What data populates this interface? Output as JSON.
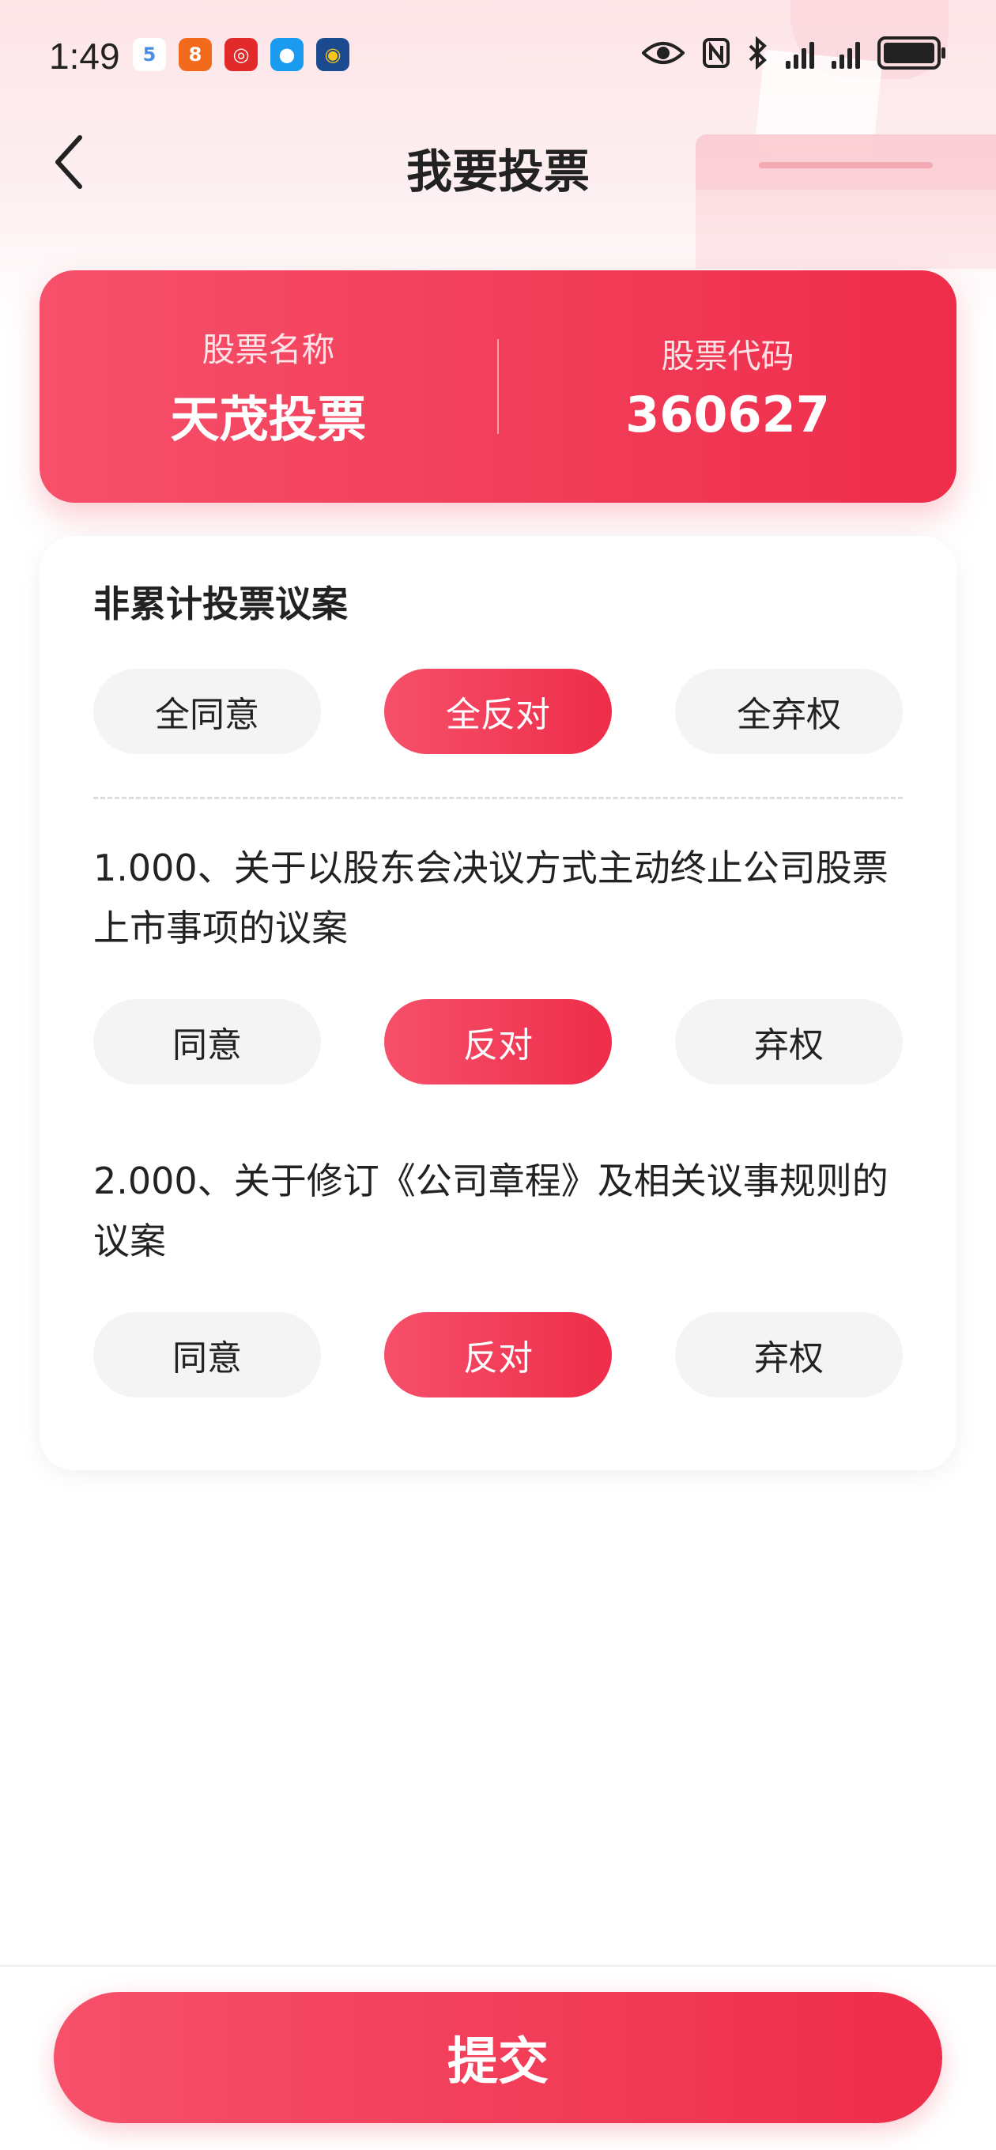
{
  "status_bar": {
    "time": "1:49",
    "apps": [
      {
        "icon": "app-5-icon",
        "glyph": "5",
        "color": "#4a90e2"
      },
      {
        "icon": "app-orange-icon",
        "glyph": "8",
        "color": "#f26a1b"
      },
      {
        "icon": "app-red-icon",
        "glyph": "◎",
        "color": "#e32a2a"
      },
      {
        "icon": "app-chat-icon",
        "glyph": "●",
        "color": "#1a9bf0"
      },
      {
        "icon": "app-circle-icon",
        "glyph": "◉",
        "color": "#1b4a8f"
      }
    ]
  },
  "header": {
    "title": "我要投票"
  },
  "stock": {
    "name_label": "股票名称",
    "name_value": "天茂投票",
    "code_label": "股票代码",
    "code_value": "360627"
  },
  "section": {
    "title": "非累计投票议案",
    "all_buttons": {
      "agree": "全同意",
      "oppose": "全反对",
      "abstain": "全弃权",
      "selected": "oppose"
    }
  },
  "proposals": [
    {
      "text": "1.000、关于以股东会决议方式主动终止公司股票上市事项的议案",
      "agree": "同意",
      "oppose": "反对",
      "abstain": "弃权",
      "selected": "oppose"
    },
    {
      "text": "2.000、关于修订《公司章程》及相关议事规则的议案",
      "agree": "同意",
      "oppose": "反对",
      "abstain": "弃权",
      "selected": "oppose"
    }
  ],
  "submit_label": "提交",
  "colors": {
    "accent_start": "#f6506a",
    "accent_end": "#ee2d4a",
    "pill_bg": "#f4f4f4"
  }
}
